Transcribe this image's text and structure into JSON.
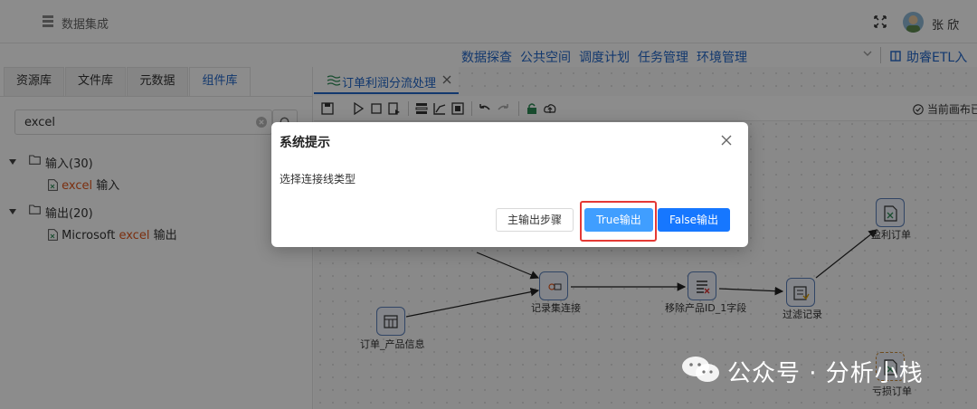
{
  "app": {
    "title": "数据集成",
    "user": "张 欣"
  },
  "nav": {
    "items": [
      "数据探查",
      "公共空间",
      "调度计划",
      "任务管理",
      "环境管理"
    ],
    "help": "助睿ETL入门"
  },
  "sidebar": {
    "tabs": [
      "资源库",
      "文件库",
      "元数据",
      "组件库"
    ],
    "active_tab": "组件库",
    "search": {
      "value": "excel"
    },
    "tree": {
      "input_group": "输入(30)",
      "input_item_hl": "excel",
      "input_item_rest": " 输入",
      "output_group": "输出(20)",
      "output_item_pre": "Microsoft ",
      "output_item_hl": "excel",
      "output_item_rest": " 输出"
    }
  },
  "editor": {
    "tab_title": "订单利润分流处理",
    "canvas_status": "当前画布已",
    "nodes": {
      "orders_products": "订单_产品信息",
      "join": "记录集连接",
      "remove_field": "移除产品ID_1字段",
      "filter": "过滤记录",
      "profit": "盈利订单",
      "loss": "亏损订单"
    }
  },
  "dialog": {
    "title": "系统提示",
    "message": "选择连接线类型",
    "buttons": {
      "main": "主输出步骤",
      "true": "True输出",
      "false": "False输出"
    }
  },
  "watermark": {
    "text": "公众号 · 分析小栈"
  },
  "colors": {
    "accent": "#2266c9",
    "primary_button": "#1677ff",
    "highlight": "#e53935",
    "keyword": "#e0561d"
  }
}
